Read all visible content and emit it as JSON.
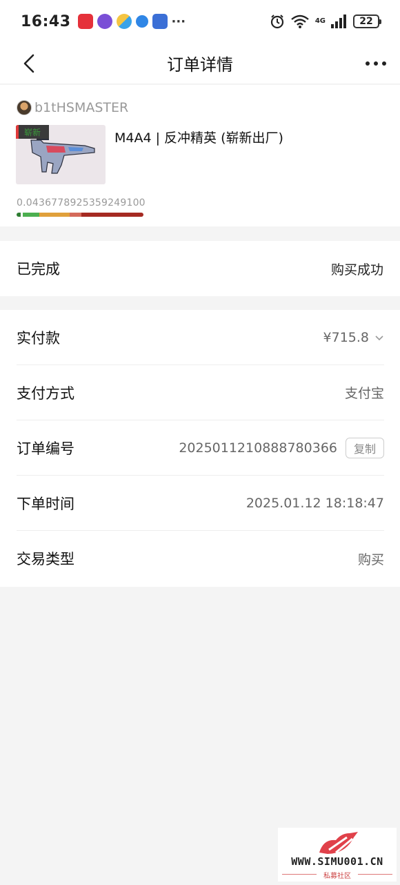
{
  "status_bar": {
    "time": "16:43",
    "dots": "···",
    "network": "4G",
    "signal_sup": "6",
    "battery": "22",
    "icons": [
      "app-icon-1",
      "app-icon-2",
      "app-icon-3",
      "app-icon-4",
      "app-icon-5",
      "alarm-icon",
      "wifi-icon",
      "signal-icon",
      "battery-icon"
    ]
  },
  "nav": {
    "title": "订单详情",
    "back_icon": "back-arrow-icon",
    "more_icon": "more-icon"
  },
  "product": {
    "seller": "b1tHSMASTER",
    "name": "M4A4 | 反冲精英 (崭新出厂)",
    "badge": "崭新",
    "float": "0.0436778925359249100",
    "wear_colors": [
      "#2e7d32",
      "#4caf50",
      "#e0a03b",
      "#d46a5a",
      "#a52a22"
    ]
  },
  "status": {
    "main": "已完成",
    "sub": "购买成功"
  },
  "details": [
    {
      "label": "实付款",
      "value": "¥715.8"
    },
    {
      "label": "支付方式",
      "value": "支付宝"
    },
    {
      "label": "订单编号",
      "value": "2025011210888780366",
      "action": "复制"
    },
    {
      "label": "下单时间",
      "value": "2025.01.12 18:18:47"
    },
    {
      "label": "交易类型",
      "value": "购买"
    }
  ],
  "watermark": {
    "url": "WWW.SIMU001.CN",
    "sub": "私募社区"
  }
}
